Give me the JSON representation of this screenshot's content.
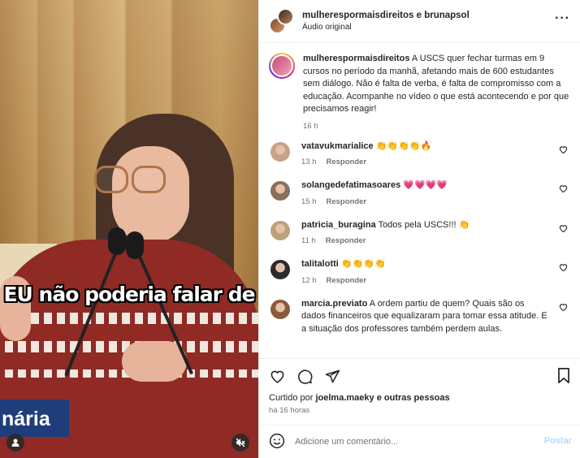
{
  "video": {
    "caption": "EU não poderia falar de",
    "lower_third": "nária"
  },
  "header": {
    "names": "mulherespormaisdireitos e brunapsol",
    "audio": "Áudio original"
  },
  "post": {
    "username": "mulherespormaisdireitos",
    "caption": "A USCS quer fechar turmas em 9 cursos no período da manhã, afetando mais de 600 estudantes sem diálogo. Não é falta de verba, é falta de compromisso com a educação. Acompanhe no vídeo o que está acontecendo e por que precisamos reagir!",
    "time": "16 h"
  },
  "comments": [
    {
      "user": "vatavukmarialice",
      "text": "👏👏👏👏🔥",
      "time": "13 h",
      "reply": "Responder",
      "avatar_color": "#c9a08a"
    },
    {
      "user": "solangedefatimasoares",
      "text": "💗💗💗💗",
      "time": "15 h",
      "reply": "Responder",
      "avatar_color": "#8a6f5c"
    },
    {
      "user": "patricia_buragina",
      "text": "Todos pela USCS!!! 👏",
      "time": "11 h",
      "reply": "Responder",
      "avatar_color": "#b9a27a"
    },
    {
      "user": "talitalotti",
      "text": "👏👏👏👏",
      "time": "12 h",
      "reply": "Responder",
      "avatar_color": "#2b2b2b"
    },
    {
      "user": "marcia.previato",
      "text": "A ordem partiu de quem? Quais são os dados financeiros que equalizaram para tomar essa atitude. E a situação dos professores também perdem aulas.",
      "time": "",
      "reply": "",
      "avatar_color": "#8b5a3c"
    }
  ],
  "likes": {
    "prefix": "Curtido por",
    "user": "joelma.maeky",
    "suffix": "e outras pessoas"
  },
  "ago": "há 16 horas",
  "add_comment": {
    "placeholder": "Adicione um comentário...",
    "post": "Postar"
  }
}
